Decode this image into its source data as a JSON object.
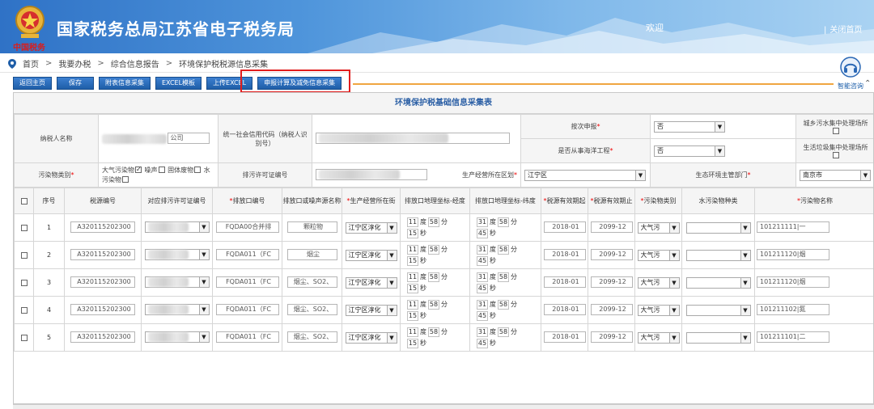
{
  "header": {
    "title": "国家税务总局江苏省电子税务局",
    "brand_script": "中国税务",
    "welcome": "欢迎",
    "close_home": "关闭首页"
  },
  "breadcrumb": [
    "首页",
    "我要办税",
    "综合信息报告",
    "环境保护税税源信息采集"
  ],
  "toolbar": [
    "返回主页",
    "保存",
    "附表信息采集",
    "EXCEL模板",
    "上传EXCEL",
    "申报计算及减免信息采集"
  ],
  "help": {
    "label": "智能咨询"
  },
  "form": {
    "title": "环境保护税基础信息采集表",
    "taxpayer_name_label": "纳税人名称",
    "taxpayer_name_value": "公司",
    "credit_code_label": "统一社会信用代码（纳税人识别号）",
    "declare_by_count_label": "按次申报",
    "declare_by_count_value": "否",
    "marine_project_label": "是否从事海洋工程",
    "marine_project_value": "否",
    "urban_sewage_label": "城乡污水集中处理场所",
    "urban_garbage_label": "生活垃圾集中处理场所",
    "pollutant_category_label": "污染物类别",
    "pollutant_options": [
      {
        "label": "大气污染物",
        "checked": true
      },
      {
        "label": "噪声",
        "checked": false
      },
      {
        "label": "固体废物",
        "checked": false
      },
      {
        "label": "水污染物",
        "checked": false
      }
    ],
    "permit_no_label": "排污许可证编号",
    "district_label": "生产经营所在区划",
    "district_value": "江宁区",
    "env_dept_label": "生态环境主管部门",
    "env_dept_value": "南京市"
  },
  "grid": {
    "headers": [
      "序号",
      "税源编号",
      "对应排污许可证编号",
      "排放口编号",
      "排放口或噪声源名称",
      "生产经营所在街",
      "排放口地理坐标-经度",
      "排放口地理坐标-纬度",
      "税源有效期起",
      "税源有效期止",
      "污染物类别",
      "水污染物种类",
      "污染物名称"
    ],
    "required": [
      false,
      false,
      false,
      true,
      false,
      true,
      false,
      false,
      true,
      true,
      true,
      false,
      true
    ],
    "unit_deg": "度",
    "unit_min": "分",
    "unit_sec": "秒",
    "rows": [
      {
        "no": "1",
        "tax_id": "A320115202300",
        "outlet": "FQDA00合并排",
        "name": "颗粒物",
        "street": "江宁区淳化",
        "lng": [
          "11",
          "58",
          "15"
        ],
        "lat": [
          "31",
          "58",
          "45"
        ],
        "start": "2018-01",
        "end": "2099-12",
        "cat": "大气污",
        "pollutant": "101211111|一"
      },
      {
        "no": "2",
        "tax_id": "A320115202300",
        "outlet": "FQDA011（FC",
        "name": "烟尘",
        "street": "江宁区淳化",
        "lng": [
          "11",
          "58",
          "15"
        ],
        "lat": [
          "31",
          "58",
          "45"
        ],
        "start": "2018-01",
        "end": "2099-12",
        "cat": "大气污",
        "pollutant": "101211120|烟"
      },
      {
        "no": "3",
        "tax_id": "A320115202300",
        "outlet": "FQDA011（FC",
        "name": "烟尘、SO2、",
        "street": "江宁区淳化",
        "lng": [
          "11",
          "58",
          "15"
        ],
        "lat": [
          "31",
          "58",
          "45"
        ],
        "start": "2018-01",
        "end": "2099-12",
        "cat": "大气污",
        "pollutant": "101211120|烟"
      },
      {
        "no": "4",
        "tax_id": "A320115202300",
        "outlet": "FQDA011（FC",
        "name": "烟尘、SO2、",
        "street": "江宁区淳化",
        "lng": [
          "11",
          "58",
          "15"
        ],
        "lat": [
          "31",
          "58",
          "45"
        ],
        "start": "2018-01",
        "end": "2099-12",
        "cat": "大气污",
        "pollutant": "101211102|氮"
      },
      {
        "no": "5",
        "tax_id": "A320115202300",
        "outlet": "FQDA011（FC",
        "name": "烟尘、SO2、",
        "street": "江宁区淳化",
        "lng": [
          "11",
          "58",
          "15"
        ],
        "lat": [
          "31",
          "58",
          "45"
        ],
        "start": "2018-01",
        "end": "2099-12",
        "cat": "大气污",
        "pollutant": "101211101|二"
      }
    ]
  }
}
